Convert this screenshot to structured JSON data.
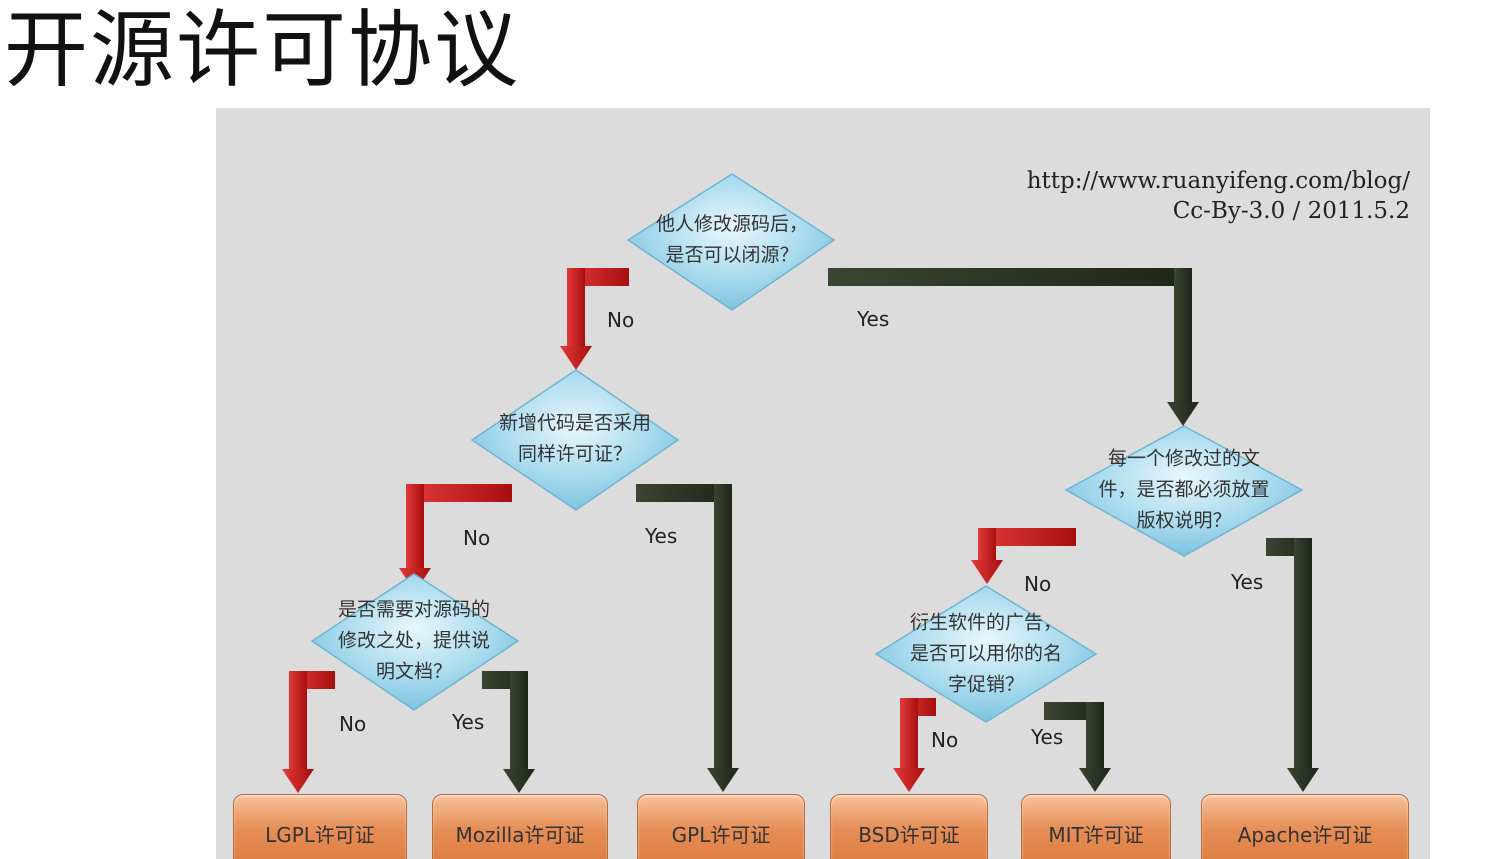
{
  "title": "开源许可协议",
  "credit": {
    "url": "http://www.ruanyifeng.com/blog/",
    "license_date": "Cc-By-3.0 / 2011.5.2"
  },
  "colors": {
    "no_arrow": "#cc1a1a",
    "yes_arrow": "#2b3520",
    "diamond": "#9fd3e8",
    "license_box": "#e58d55"
  },
  "questions": {
    "q1": "他人修改源码后，\n是否可以闭源？",
    "q2": "新增代码是否采用\n同样许可证？",
    "q3": "是否需要对源码的\n修改之处，提供说\n明文档？",
    "q4": "每一个修改过的文\n件，是否都必须放置\n版权说明？",
    "q5": "衍生软件的广告，\n是否可以用你的名\n字促销？"
  },
  "edge_labels": {
    "no": "No",
    "yes": "Yes"
  },
  "licenses": {
    "lgpl": "LGPL许可证",
    "mozilla": "Mozilla许可证",
    "gpl": "GPL许可证",
    "bsd": "BSD许可证",
    "mit": "MIT许可证",
    "apache": "Apache许可证"
  }
}
